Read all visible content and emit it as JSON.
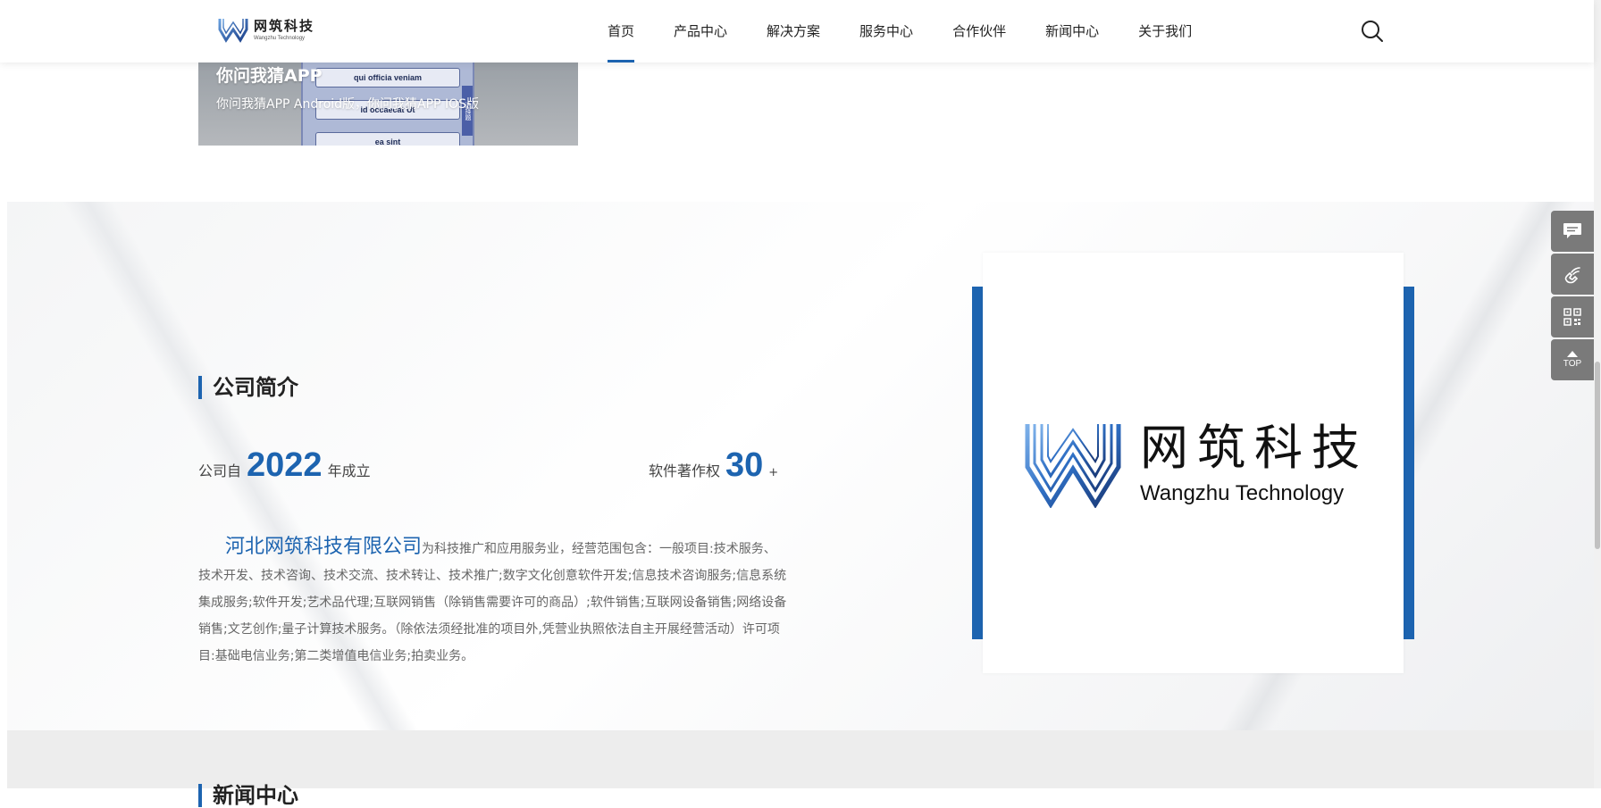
{
  "header": {
    "logo": {
      "cn": "网筑科技",
      "en": "Wangzhu Technology"
    },
    "nav": [
      {
        "label": "首页",
        "active": true
      },
      {
        "label": "产品中心"
      },
      {
        "label": "解决方案"
      },
      {
        "label": "服务中心"
      },
      {
        "label": "合作伙伴"
      },
      {
        "label": "新闻中心"
      },
      {
        "label": "关于我们"
      }
    ],
    "search_icon": "search-icon"
  },
  "app_card": {
    "title": "你问我猜APP",
    "subtitle": "你问我猜APP Android版，你问我猜APP IOS版",
    "phone_rows": [
      "qui officia veniam",
      "id occaecat Ut",
      "ea sint"
    ],
    "phone_tab": "选择题"
  },
  "intro": {
    "title": "公司简介",
    "founded_prefix": "公司自",
    "founded_year": "2022",
    "founded_suffix": "年成立",
    "copyright_label": "软件著作权",
    "copyright_count": "30",
    "copyright_plus": "+",
    "company_name": "河北网筑科技有限公司",
    "description": "为科技推广和应用服务业，经营范围包含：一般项目:技术服务、技术开发、技术咨询、技术交流、技术转让、技术推广;数字文化创意软件开发;信息技术咨询服务;信息系统集成服务;软件开发;艺术品代理;互联网销售（除销售需要许可的商品）;软件销售;互联网设备销售;网络设备销售;文艺创作;量子计算技术服务。（除依法须经批准的项目外,凭营业执照依法自主开展经营活动）许可项目:基础电信业务;第二类增值电信业务;拍卖业务。",
    "logo_cn": "网筑科技",
    "logo_en": "Wangzhu Technology"
  },
  "news": {
    "title": "新闻中心"
  },
  "sidebar": {
    "buttons": [
      {
        "icon": "message-icon"
      },
      {
        "icon": "phone-icon"
      },
      {
        "icon": "qrcode-icon"
      },
      {
        "icon": "back-to-top-icon",
        "label": "TOP"
      }
    ]
  },
  "colors": {
    "accent": "#1d64b0",
    "sidebar": "#7a7a7a"
  }
}
